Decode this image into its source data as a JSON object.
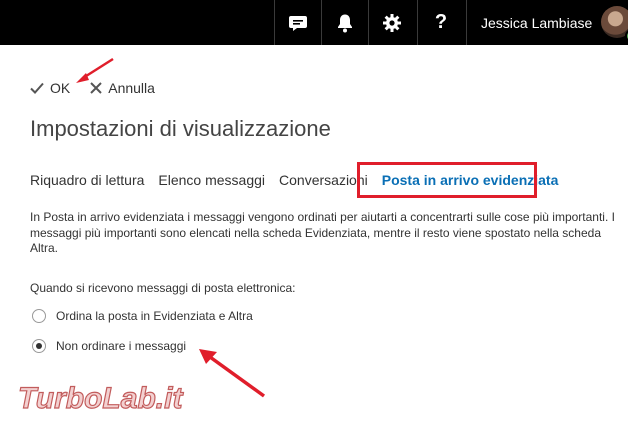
{
  "topbar": {
    "icons": [
      "chat-icon",
      "bell-icon",
      "gear-icon",
      "help-icon"
    ],
    "help_label": "?",
    "user_name": "Jessica Lambiase",
    "status_color": "#5cb85c"
  },
  "actions": {
    "ok_label": "OK",
    "cancel_label": "Annulla"
  },
  "page_title": "Impostazioni di visualizzazione",
  "tabs": [
    {
      "label": "Riquadro di lettura",
      "active": false
    },
    {
      "label": "Elenco messaggi",
      "active": false
    },
    {
      "label": "Conversazioni",
      "active": false
    },
    {
      "label": "Posta in arrivo evidenziata",
      "active": true
    }
  ],
  "description": "In Posta in arrivo evidenziata i messaggi vengono ordinati per aiutarti a concentrarti sulle cose più importanti. I messaggi più importanti sono elencati nella scheda Evidenziata, mentre il resto viene spostato nella scheda Altra.",
  "question": "Quando si ricevono messaggi di posta elettronica:",
  "options": [
    {
      "label": "Ordina la posta in Evidenziata e Altra",
      "checked": false
    },
    {
      "label": "Non ordinare i messaggi",
      "checked": true
    }
  ],
  "watermark": "TurboLab.it",
  "colors": {
    "accent": "#0a6fb5",
    "highlight": "#e01e2b",
    "topbar": "#000000"
  }
}
